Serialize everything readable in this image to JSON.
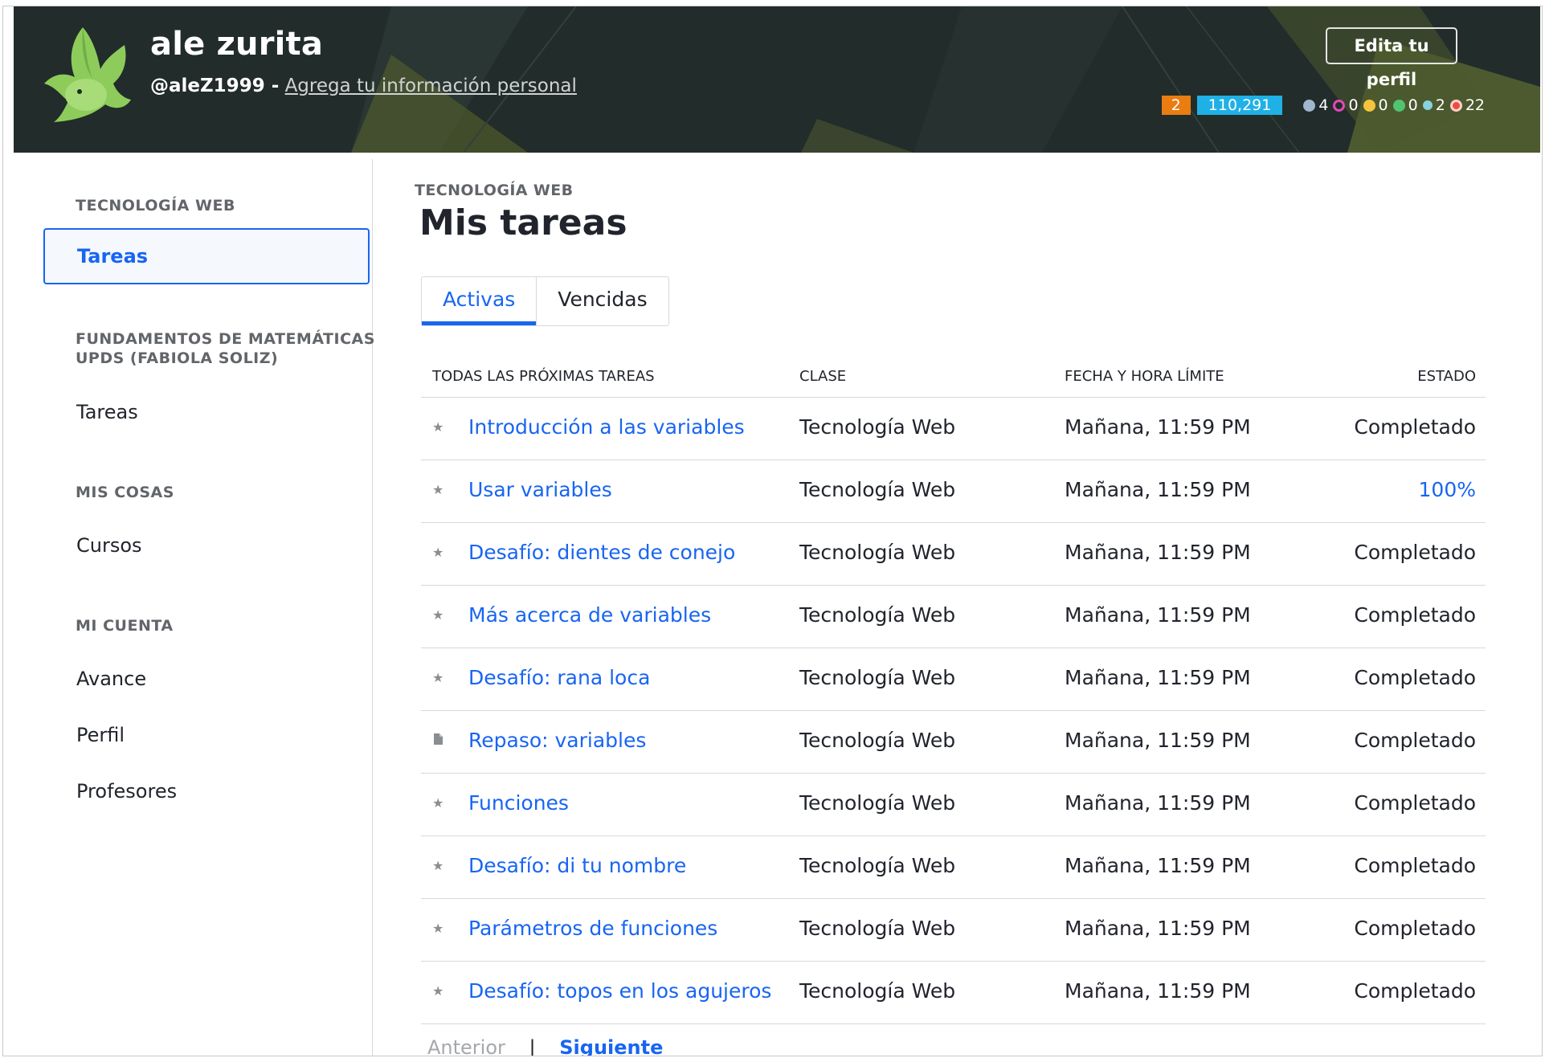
{
  "header": {
    "user_name": "ale zurita",
    "handle": "@aleZ1999 -",
    "add_info": "Agrega tu información personal",
    "edit_profile": "Edita tu perfil",
    "streak": "2",
    "points": "110,291",
    "badges": [
      {
        "icon": "meteorite-badge-icon",
        "count": "4",
        "color": "#9fb8cf"
      },
      {
        "icon": "moon-badge-icon",
        "count": "0",
        "color": "#e04bb4"
      },
      {
        "icon": "earth-badge-icon",
        "count": "0",
        "color": "#f6c33c"
      },
      {
        "icon": "sun-badge-icon",
        "count": "0",
        "color": "#51c471"
      },
      {
        "icon": "black-hole-badge-icon",
        "count": "2",
        "color": "#8ad1de"
      },
      {
        "icon": "challenge-patch-icon",
        "count": "22",
        "color": "#f04b3c"
      }
    ],
    "colors": {
      "streak": "#e97d11",
      "points": "#1fb1e6",
      "background": "#222c2a"
    }
  },
  "sidebar": {
    "sections": [
      {
        "heading": "TECNOLOGÍA WEB",
        "items": [
          "Tareas"
        ]
      },
      {
        "heading": "FUNDAMENTOS DE MATEMÁTICAS UPDS (FABIOLA SOLIZ)",
        "items": [
          "Tareas"
        ]
      },
      {
        "heading": "MIS COSAS",
        "items": [
          "Cursos"
        ]
      },
      {
        "heading": "MI CUENTA",
        "items": [
          "Avance",
          "Perfil",
          "Profesores"
        ]
      }
    ]
  },
  "main": {
    "breadcrumb": "TECNOLOGÍA WEB",
    "title": "Mis tareas",
    "tabs": [
      "Activas",
      "Vencidas"
    ],
    "columns": [
      "TODAS LAS PRÓXIMAS TAREAS",
      "CLASE",
      "FECHA Y HORA LÍMITE",
      "ESTADO"
    ],
    "rows": [
      {
        "icon": "star-icon",
        "task": "Introducción a las variables",
        "class": "Tecnología Web",
        "due": "Mañana, 11:59 PM",
        "status": "Completado"
      },
      {
        "icon": "star-icon",
        "task": "Usar variables",
        "class": "Tecnología Web",
        "due": "Mañana, 11:59 PM",
        "status": "100%"
      },
      {
        "icon": "star-icon",
        "task": "Desafío: dientes de conejo",
        "class": "Tecnología Web",
        "due": "Mañana, 11:59 PM",
        "status": "Completado"
      },
      {
        "icon": "star-icon",
        "task": "Más acerca de variables",
        "class": "Tecnología Web",
        "due": "Mañana, 11:59 PM",
        "status": "Completado"
      },
      {
        "icon": "star-icon",
        "task": "Desafío: rana loca",
        "class": "Tecnología Web",
        "due": "Mañana, 11:59 PM",
        "status": "Completado"
      },
      {
        "icon": "document-icon",
        "task": "Repaso: variables",
        "class": "Tecnología Web",
        "due": "Mañana, 11:59 PM",
        "status": "Completado"
      },
      {
        "icon": "star-icon",
        "task": "Funciones",
        "class": "Tecnología Web",
        "due": "Mañana, 11:59 PM",
        "status": "Completado"
      },
      {
        "icon": "star-icon",
        "task": "Desafío: di tu nombre",
        "class": "Tecnología Web",
        "due": "Mañana, 11:59 PM",
        "status": "Completado"
      },
      {
        "icon": "star-icon",
        "task": "Parámetros de funciones",
        "class": "Tecnología Web",
        "due": "Mañana, 11:59 PM",
        "status": "Completado"
      },
      {
        "icon": "star-icon",
        "task": "Desafío: topos en los agujeros",
        "class": "Tecnología Web",
        "due": "Mañana, 11:59 PM",
        "status": "Completado"
      }
    ],
    "pager": {
      "prev": "Anterior",
      "separator": "|",
      "next": "Siguiente"
    },
    "accent_color": "#1865f2"
  }
}
